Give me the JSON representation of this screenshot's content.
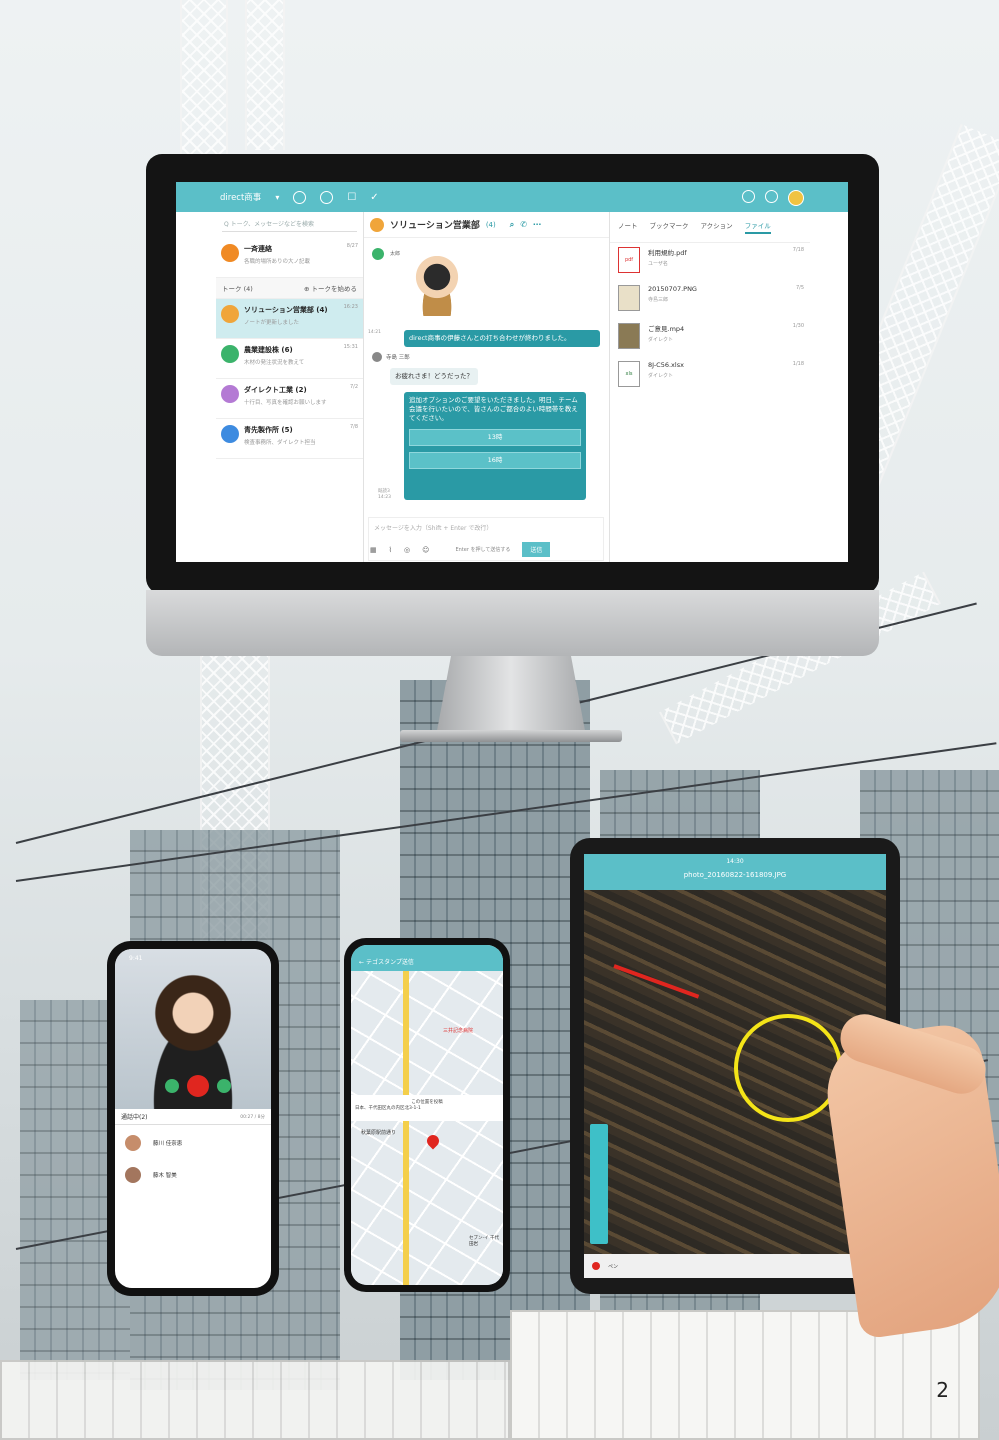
{
  "monitor": {
    "app_name": "direct商事",
    "search_placeholder": "Q トーク、メッセージなどを検索",
    "talk_header": "トーク (4)",
    "start_talk": "⊕ トークを始める",
    "channel_title": "ソリューション営業部",
    "channel_count": "(4)",
    "top_items": [
      {
        "name": "一斉連絡",
        "preview": "各職的場所ありの大ノ記載",
        "time": "8/27",
        "color": "#f08a24"
      }
    ],
    "talks": [
      {
        "name": "ソリューション営業部 (4)",
        "preview": "ノートが更新しました",
        "time": "16:23",
        "color": "#f0a53a",
        "selected": true
      },
      {
        "name": "農業建設株 (6)",
        "preview": "木材の発注状況を教えて",
        "time": "15:31",
        "color": "#3bb36b",
        "selected": false
      },
      {
        "name": "ダイレクト工業 (2)",
        "preview": "十行目、写真を確認お願いします",
        "time": "7/2",
        "color": "#b47ad4",
        "selected": false
      },
      {
        "name": "青先製作所 (5)",
        "preview": "検査事務所、ダイレクト担当",
        "time": "7/8",
        "color": "#3d8be0",
        "selected": false
      }
    ],
    "messages": {
      "stamp_sender": "太郎",
      "system_text": "direct商事の伊藤さんとの打ち合わせが終わりました。",
      "sender2": "寺島 三郎",
      "user_msg": "お疲れさま！どうだった？",
      "long_text": "追加オプションのご要望をいただきました。明日、チーム会議を行いたいので、皆さんのご都合のよい時間帯を教えてください。",
      "option1": "13時",
      "option2": "16時",
      "read_label": "既読3",
      "time1": "14:21",
      "time2": "14:23"
    },
    "input_placeholder": "メッセージを入力（Shift + Enter で改行）",
    "send_hint": "Enter を押して送信する",
    "send_button": "送信",
    "tabs": [
      "ノート",
      "ブックマーク",
      "アクション",
      "ファイル"
    ],
    "files": [
      {
        "type": "pdf",
        "name": "利用規約.pdf",
        "user": "ユーザ名",
        "date": "7/18"
      },
      {
        "type": "img",
        "name": "20150707.PNG",
        "user": "寺島三郎",
        "date": "7/5"
      },
      {
        "type": "mp4",
        "name": "ご意見.mp4",
        "user": "ダイレクト",
        "date": "1/30"
      },
      {
        "type": "xls",
        "name": "8J-C56.xlsx",
        "user": "ダイレクト",
        "date": "1/18"
      }
    ]
  },
  "phone1": {
    "time": "9:41",
    "call_status": "通話中(2)",
    "duration": "00:27 / 8分",
    "participants": [
      "藤川 佳奈恵",
      "藤木 智美"
    ]
  },
  "phone2": {
    "title": "テゴスタンプ送信",
    "location_label": "この位置を投稿",
    "address": "日本、千代田区丸の内区北3-1-1",
    "place": "三井記念病院",
    "nearby": "秋葉原駅前通り",
    "store": "セブン-イ 千代田岩"
  },
  "tablet": {
    "status_time": "14:30",
    "photo_title": "photo_20160822-161809.JPG",
    "tool_label": "ペン"
  },
  "page_number": "2",
  "colors": {
    "accent": "#5bbfc8",
    "annotation": "#f4e418",
    "arrow": "#e0261f"
  }
}
